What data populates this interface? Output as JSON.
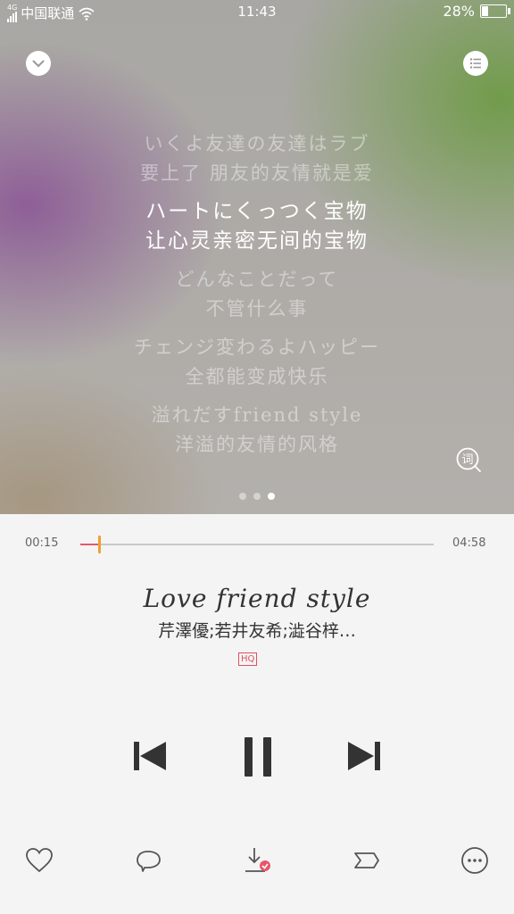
{
  "status_bar": {
    "network_type": "4G",
    "carrier": "中国联通",
    "time": "11:43",
    "battery": "28%",
    "icons": [
      "signal-icon",
      "wifi-icon",
      "battery-icon"
    ]
  },
  "header": {
    "collapse_icon": "chevron-down-icon",
    "playlist_icon": "playlist-icon"
  },
  "lyrics": [
    {
      "jp": "いくよ友達の友達はラブ",
      "cn": "要上了 朋友的友情就是爱",
      "active": false
    },
    {
      "jp": "ハートにくっつく宝物",
      "cn": "让心灵亲密无间的宝物",
      "active": true
    },
    {
      "jp": "どんなことだって",
      "cn": "不管什么事",
      "active": false
    },
    {
      "jp": "チェンジ変わるよハッピー",
      "cn": "全都能变成快乐",
      "active": false
    },
    {
      "jp": "溢れだすfriend style",
      "cn": "洋溢的友情的风格",
      "active": false
    }
  ],
  "lyric_search_icon": "lyric-search-icon",
  "lyric_search_glyph": "词",
  "page_dots": {
    "count": 3,
    "active": 3
  },
  "player": {
    "elapsed": "00:15",
    "total": "04:58",
    "progress": 0.052,
    "title": "Love friend style",
    "artist": "芹澤優;若井友希;澁谷梓…",
    "quality": "HQ"
  },
  "controls": [
    "previous-icon",
    "pause-icon",
    "next-icon"
  ],
  "actions": [
    "heart-icon",
    "comment-icon",
    "download-icon",
    "share-icon",
    "more-icon"
  ],
  "colors": {
    "accent": "#e8566a",
    "thumb": "#f0a030",
    "text": "#333333"
  }
}
